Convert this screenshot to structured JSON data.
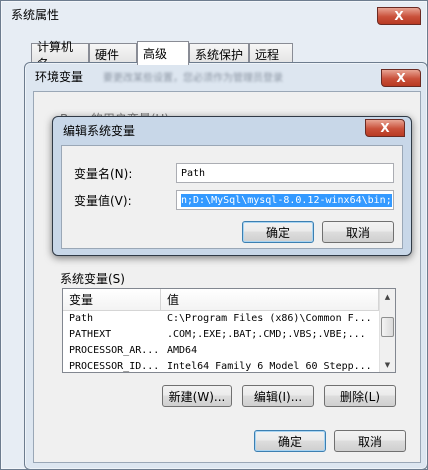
{
  "system_properties": {
    "title": "系统属性",
    "tabs": [
      "计算机名",
      "硬件",
      "高级",
      "系统保护",
      "远程"
    ],
    "active_tab": "高级"
  },
  "env_vars": {
    "title": "环境变量",
    "blurred_hint": "要更改某些设置，您必须作为管理员登录",
    "user_vars_label": "Ba... 的用户变量(U)",
    "system_vars_label": "系统变量(S)",
    "columns": [
      "变量",
      "值"
    ],
    "rows": [
      {
        "name": "Path",
        "value": "C:\\Program Files (x86)\\Common F..."
      },
      {
        "name": "PATHEXT",
        "value": ".COM;.EXE;.BAT;.CMD;.VBS;.VBE;..."
      },
      {
        "name": "PROCESSOR_AR...",
        "value": "AMD64"
      },
      {
        "name": "PROCESSOR_ID...",
        "value": "Intel64 Family 6 Model 60 Stepp..."
      }
    ],
    "buttons": {
      "new": "新建(W)...",
      "edit": "编辑(I)...",
      "delete": "删除(L)",
      "ok": "确定",
      "cancel": "取消"
    }
  },
  "edit_dialog": {
    "title": "编辑系统变量",
    "name_label": "变量名(N):",
    "value_label": "变量值(V):",
    "name_value": "Path",
    "value_value": "n;D:\\MySql\\mysql-8.0.12-winx64\\bin;",
    "ok": "确定",
    "cancel": "取消"
  },
  "close_glyph": "X"
}
